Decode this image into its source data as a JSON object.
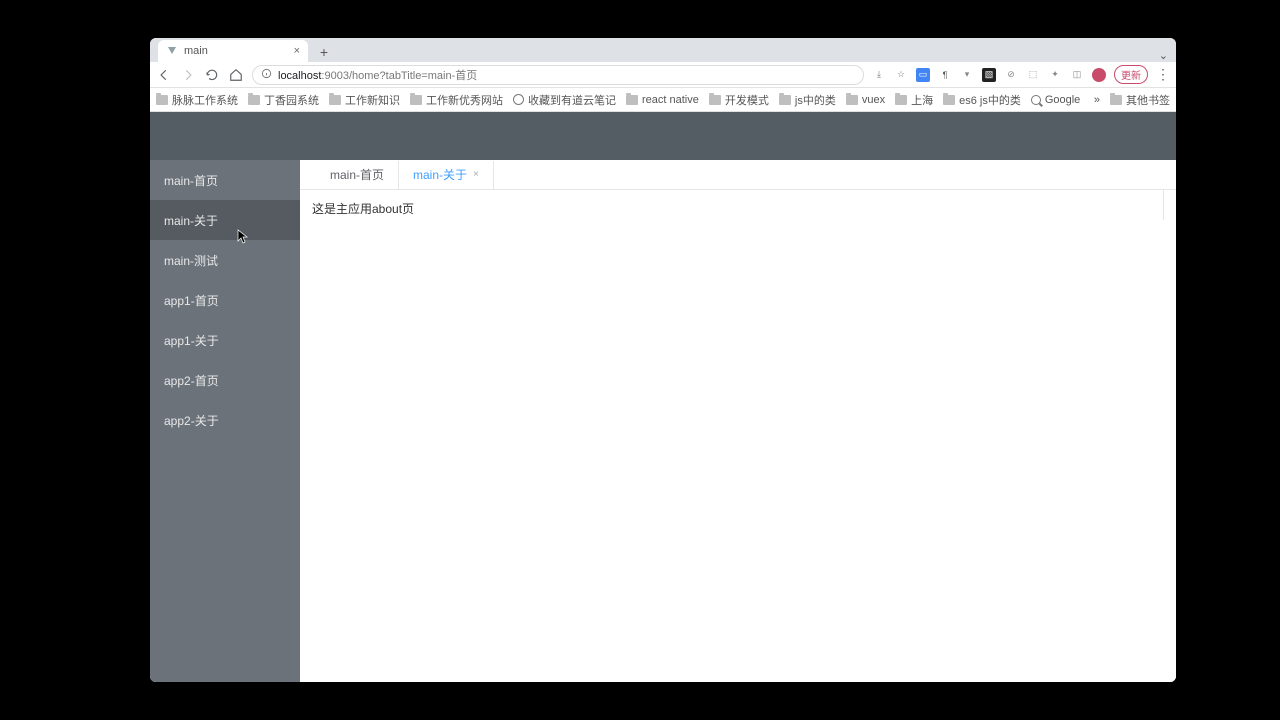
{
  "browser": {
    "tab": {
      "title": "main",
      "close": "×"
    },
    "new_tab": "+",
    "nav": {
      "back": "←",
      "forward": "→",
      "reload": "⟳",
      "home": "⌂"
    },
    "address": {
      "host": "localhost",
      "port": ":9003",
      "path": "/home?tabTitle=main-首页"
    },
    "update_label": "更新",
    "bookmarks": [
      {
        "label": "脉脉工作系统",
        "icon": "folder"
      },
      {
        "label": "丁香园系统",
        "icon": "folder"
      },
      {
        "label": "工作新知识",
        "icon": "folder"
      },
      {
        "label": "工作新优秀网站",
        "icon": "folder"
      },
      {
        "label": "收藏到有道云笔记",
        "icon": "globe"
      },
      {
        "label": "react native",
        "icon": "folder"
      },
      {
        "label": "开发模式",
        "icon": "folder"
      },
      {
        "label": "js中的类",
        "icon": "folder"
      },
      {
        "label": "vuex",
        "icon": "folder"
      },
      {
        "label": "上海",
        "icon": "folder"
      },
      {
        "label": "es6 js中的类",
        "icon": "folder"
      },
      {
        "label": "Google",
        "icon": "search"
      }
    ],
    "bookmarks_overflow": "»",
    "other_bookmarks": "其他书签"
  },
  "app": {
    "sidebar": [
      {
        "label": "main-首页",
        "hover": false
      },
      {
        "label": "main-关于",
        "hover": true
      },
      {
        "label": "main-测试",
        "hover": false
      },
      {
        "label": "app1-首页",
        "hover": false
      },
      {
        "label": "app1-关于",
        "hover": false
      },
      {
        "label": "app2-首页",
        "hover": false
      },
      {
        "label": "app2-关于",
        "hover": false
      }
    ],
    "tabs": [
      {
        "label": "main-首页",
        "active": false,
        "closable": false
      },
      {
        "label": "main-关于",
        "active": true,
        "closable": true
      }
    ],
    "tab_close": "×",
    "page_text": "这是主应用about页"
  },
  "colors": {
    "header": "#545c64",
    "sidebar": "#6b727a",
    "sidebar_hover": "#555b61",
    "tab_active": "#409eff"
  }
}
